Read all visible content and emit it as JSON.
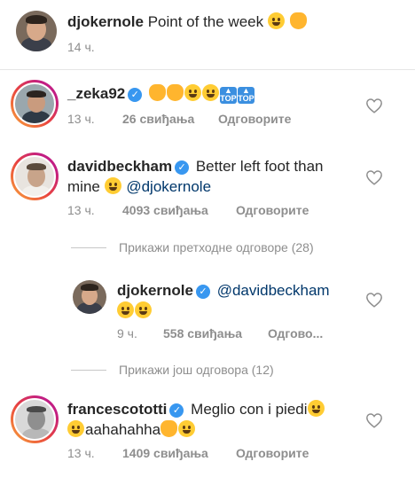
{
  "caption": {
    "username": "djokernole",
    "text": "Point of the week",
    "time": "14 ч."
  },
  "comments": [
    {
      "username": "_zeka92",
      "verified": true,
      "time": "13 ч.",
      "likes": "26 свиђања",
      "reply_label": "Одговорите"
    },
    {
      "username": "davidbeckham",
      "verified": true,
      "text": "Better left foot than",
      "text_line2": "mine",
      "mention": "@djokernole",
      "time": "13 ч.",
      "likes": "4093 свиђања",
      "reply_label": "Одговорите"
    },
    {
      "username": "djokernole",
      "verified": true,
      "mention": "@davidbeckham",
      "time": "9 ч.",
      "likes": "558 свиђања",
      "reply_label": "Одгово..."
    },
    {
      "username": "francescototti",
      "verified": true,
      "text": "Meglio con i piedi",
      "text_line2": "aahahahha",
      "time": "13 ч.",
      "likes": "1409 свиђања",
      "reply_label": "Одговорите"
    }
  ],
  "view_previous_replies": "Прикажи претходне одговоре (28)",
  "view_more_replies": "Прикажи још одговора (12)",
  "icons": {
    "heart": "heart-outline-icon",
    "verified": "verified-badge-icon"
  },
  "colors": {
    "text": "#262626",
    "secondary": "#8e8e8e",
    "mention": "#00376b",
    "verified": "#3897f0"
  }
}
